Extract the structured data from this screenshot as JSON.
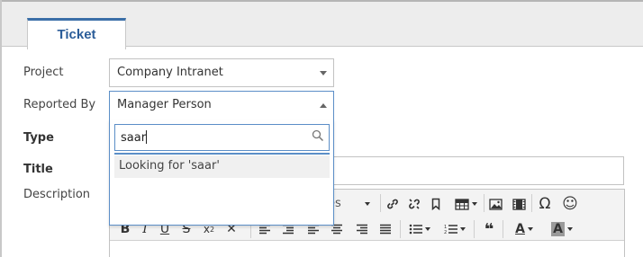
{
  "tabs": [
    {
      "label": "Ticket",
      "active": true
    }
  ],
  "form": {
    "project": {
      "label": "Project",
      "value": "Company Intranet"
    },
    "reported_by": {
      "label": "Reported By",
      "value": "Manager Person"
    },
    "type": {
      "label": "Type"
    },
    "title": {
      "label": "Title",
      "value": ""
    },
    "description": {
      "label": "Description"
    }
  },
  "dropdown": {
    "search_text": "saar",
    "options": [
      "Looking for 'saar'"
    ]
  },
  "editor": {
    "style_select_partial": "es",
    "toolbar_row1": [
      "link-icon",
      "unlink-icon",
      "bookmark-icon",
      "table-icon",
      "image-icon",
      "video-icon",
      "omega-icon",
      "smiley-icon"
    ],
    "toolbar_row2": [
      "bold-icon",
      "italic-icon",
      "underline-icon",
      "strikethrough-icon",
      "subscript-icon",
      "remove-format-icon",
      "align-left-icon",
      "indent-icon",
      "align-center-icon",
      "align-justify-icon",
      "align-right-icon",
      "justify-icon",
      "bullet-list-icon",
      "numbered-list-icon",
      "blockquote-icon",
      "text-color-icon",
      "background-color-icon"
    ],
    "glyphs": {
      "omega": "Ω",
      "smiley": "☺",
      "quote": "❝",
      "text_color": "A",
      "bg_color": "A"
    }
  },
  "colors": {
    "accent": "#2b5d99",
    "focus_border": "#5b8ec7"
  }
}
